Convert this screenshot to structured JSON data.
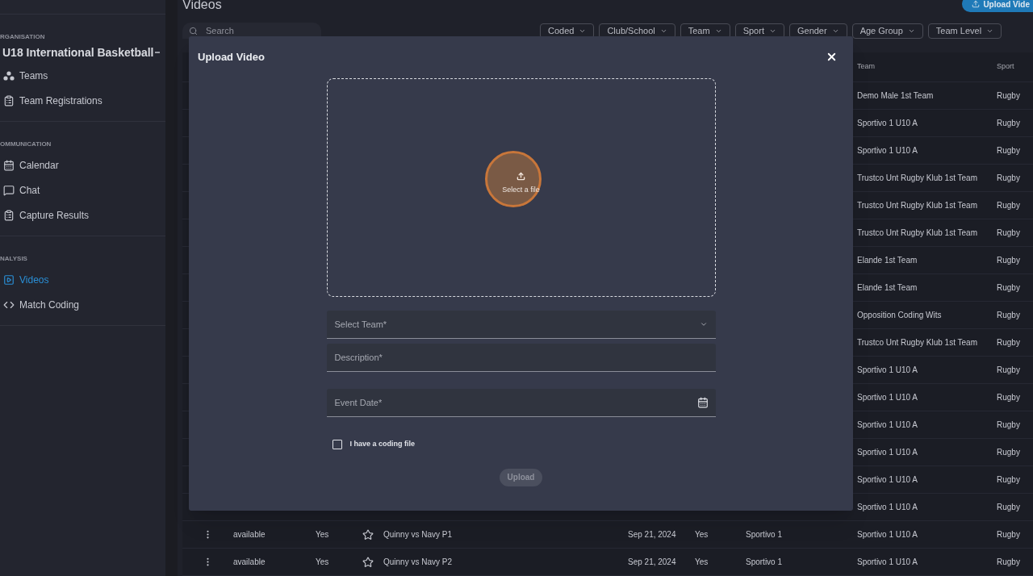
{
  "sidebar": {
    "sections": [
      {
        "label": "RGANISATION",
        "org": "U18 International Basketball",
        "items": [
          {
            "label": "Teams",
            "selected": false
          },
          {
            "label": "Team Registrations",
            "selected": false
          }
        ]
      },
      {
        "label": "OMMUNICATION",
        "items": [
          {
            "label": "Calendar",
            "selected": false
          },
          {
            "label": "Chat",
            "selected": false
          },
          {
            "label": "Capture Results",
            "selected": false
          }
        ]
      },
      {
        "label": "NALYSIS",
        "items": [
          {
            "label": "Videos",
            "selected": true
          },
          {
            "label": "Match Coding",
            "selected": false
          }
        ]
      }
    ]
  },
  "page": {
    "title": "Videos",
    "upload_button": "Upload Vide",
    "search": {
      "placeholder": "Search"
    },
    "filters": [
      "Coded",
      "Club/School",
      "Team",
      "Sport",
      "Gender",
      "Age Group",
      "Team Level"
    ]
  },
  "table": {
    "columns": [
      {
        "label": "Team"
      },
      {
        "label": "Sport"
      }
    ],
    "rows": [
      {
        "team": "Demo Male 1st Team",
        "sport": "Rugby"
      },
      {
        "team": "Sportivo 1 U10 A",
        "sport": "Rugby"
      },
      {
        "team": "Sportivo 1 U10 A",
        "sport": "Rugby"
      },
      {
        "team": "Trustco Unt Rugby Klub 1st Team",
        "sport": "Rugby"
      },
      {
        "team": "Trustco Unt Rugby Klub 1st Team",
        "sport": "Rugby"
      },
      {
        "team": "Trustco Unt Rugby Klub 1st Team",
        "sport": "Rugby"
      },
      {
        "team": "Elande 1st Team",
        "sport": "Rugby"
      },
      {
        "team": "Elande 1st Team",
        "sport": "Rugby"
      },
      {
        "team": "Opposition Coding Wits",
        "sport": "Rugby"
      },
      {
        "team": "Trustco Unt Rugby Klub 1st Team",
        "sport": "Rugby"
      },
      {
        "team": "Sportivo 1 U10 A",
        "sport": "Rugby"
      },
      {
        "team": "Sportivo 1 U10 A",
        "sport": "Rugby"
      },
      {
        "team": "Sportivo 1 U10 A",
        "sport": "Rugby"
      },
      {
        "team": "Sportivo 1 U10 A",
        "sport": "Rugby"
      },
      {
        "team": "Sportivo 1 U10 A",
        "sport": "Rugby"
      },
      {
        "team": "Sportivo 1 U10 A",
        "sport": "Rugby"
      },
      {
        "column_2": "available",
        "column_3": "Yes",
        "starred": false,
        "column_5": "Quinny vs Navy P1",
        "column_6": "Sep 21, 2024",
        "column_7": "Yes",
        "column_8": "Sportivo 1",
        "team": "Sportivo 1 U10 A",
        "sport": "Rugby"
      },
      {
        "column_2": "available",
        "column_3": "Yes",
        "starred": false,
        "column_5": "Quinny vs Navy P2",
        "column_6": "Sep 21, 2024",
        "column_7": "Yes",
        "column_8": "Sportivo 1",
        "team": "Sportivo 1 U10 A",
        "sport": "Rugby"
      }
    ]
  },
  "dialog": {
    "title": "Upload Video",
    "dropzone": {
      "label": "Select a file"
    },
    "fields": [
      {
        "kind": "select",
        "placeholder": "Select Team*"
      },
      {
        "kind": "text",
        "placeholder": "Description*"
      },
      {
        "kind": "date",
        "placeholder": "Event Date*"
      }
    ],
    "checkbox": {
      "label": "I have a coding file",
      "checked": false
    },
    "submit": {
      "label": "Upload",
      "disabled": true
    }
  }
}
